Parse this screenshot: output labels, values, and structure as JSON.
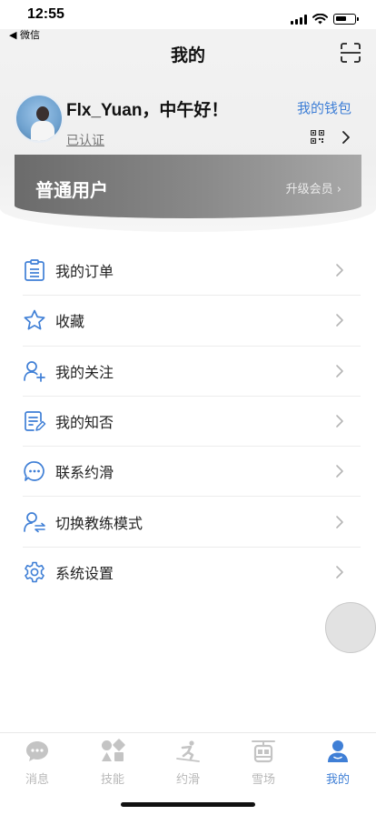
{
  "status": {
    "time": "12:55",
    "back_label": "◀ 微信"
  },
  "nav": {
    "title": "我的"
  },
  "profile": {
    "greeting": "Flx_Yuan，中午好！",
    "verified": "已认证",
    "wallet": "我的钱包"
  },
  "member": {
    "title": "普通用户",
    "upgrade": "升级会员 ›"
  },
  "menu": [
    {
      "label": "我的订单",
      "icon": "order-list-icon"
    },
    {
      "label": "收藏",
      "icon": "star-icon"
    },
    {
      "label": "我的关注",
      "icon": "add-user-icon"
    },
    {
      "label": "我的知否",
      "icon": "note-icon"
    },
    {
      "label": "联系约滑",
      "icon": "chat-bubble-icon"
    },
    {
      "label": "切换教练模式",
      "icon": "switch-user-icon"
    },
    {
      "label": "系统设置",
      "icon": "gear-icon"
    }
  ],
  "tabs": [
    {
      "label": "消息",
      "icon": "message-icon",
      "active": false
    },
    {
      "label": "技能",
      "icon": "skills-icon",
      "active": false
    },
    {
      "label": "约滑",
      "icon": "ski-icon",
      "active": false
    },
    {
      "label": "雪场",
      "icon": "cable-car-icon",
      "active": false
    },
    {
      "label": "我的",
      "icon": "profile-icon",
      "active": true
    }
  ],
  "colors": {
    "accent": "#3f7fd6",
    "tab_inactive": "#b8b8b8"
  }
}
